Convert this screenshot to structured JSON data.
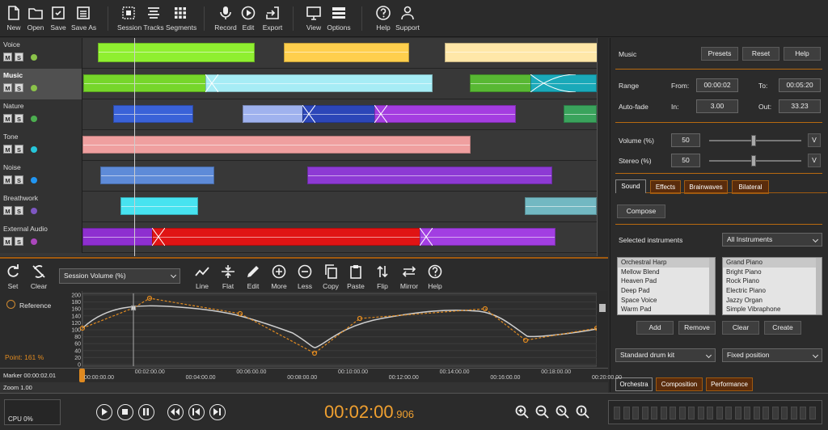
{
  "toolbar": [
    {
      "label": "New",
      "icon": "new-file-icon"
    },
    {
      "label": "Open",
      "icon": "folder-icon"
    },
    {
      "label": "Save",
      "icon": "save-icon"
    },
    {
      "label": "Save As",
      "icon": "save-as-icon"
    },
    {
      "label": "Session",
      "icon": "session-icon"
    },
    {
      "label": "Tracks",
      "icon": "tracks-icon"
    },
    {
      "label": "Segments",
      "icon": "segments-icon"
    },
    {
      "label": "Record",
      "icon": "microphone-icon"
    },
    {
      "label": "Edit",
      "icon": "edit-icon"
    },
    {
      "label": "Export",
      "icon": "export-icon"
    },
    {
      "label": "View",
      "icon": "monitor-icon"
    },
    {
      "label": "Options",
      "icon": "options-icon"
    },
    {
      "label": "Help",
      "icon": "help-icon"
    },
    {
      "label": "Support",
      "icon": "user-icon"
    }
  ],
  "tracks": [
    {
      "name": "Voice",
      "color": "#8bc34a",
      "selected": false
    },
    {
      "name": "Music",
      "color": "#8bc34a",
      "selected": true
    },
    {
      "name": "Nature",
      "color": "#4caf50",
      "selected": false
    },
    {
      "name": "Tone",
      "color": "#26c6da",
      "selected": false
    },
    {
      "name": "Noise",
      "color": "#2196f3",
      "selected": false
    },
    {
      "name": "Breathwork",
      "color": "#7e57c2",
      "selected": false
    },
    {
      "name": "External Audio",
      "color": "#ab47bc",
      "selected": false
    }
  ],
  "mute_label": "M",
  "solo_label": "S",
  "panel": {
    "title": "Music",
    "presets": "Presets",
    "reset": "Reset",
    "help": "Help",
    "range_label": "Range",
    "from_label": "From:",
    "from": "00:00:02",
    "to_label": "To:",
    "to": "00:05:20",
    "autofade_label": "Auto-fade",
    "in_label": "In:",
    "in": "3.00",
    "out_label": "Out:",
    "out": "33.23",
    "volume_label": "Volume (%)",
    "volume": "50",
    "stereo_label": "Stereo (%)",
    "stereo": "50",
    "v": "V",
    "tabs": [
      "Sound",
      "Effects",
      "Brainwaves",
      "Bilateral"
    ],
    "compose": "Compose",
    "selected_instruments": "Selected instruments",
    "instrument_filter": "All Instruments",
    "left_list": [
      "Orchestral Harp",
      "Mellow Blend",
      "Heaven Pad",
      "Deep Pad",
      "Space Voice",
      "Warm Pad"
    ],
    "right_list": [
      "Grand Piano",
      "Bright Piano",
      "Rock Piano",
      "Electric Piano",
      "Jazzy Organ",
      "Simple Vibraphone"
    ],
    "add": "Add",
    "remove": "Remove",
    "clear": "Clear",
    "create": "Create",
    "drum_kit": "Standard drum kit",
    "position": "Fixed position",
    "bottom_tabs": [
      "Orchestra",
      "Composition",
      "Performance"
    ]
  },
  "automation": {
    "set": "Set",
    "clear": "Clear",
    "dropdown": "Session Volume (%)",
    "tools": [
      "Line",
      "Flat",
      "Edit",
      "More",
      "Less",
      "Copy",
      "Paste",
      "Flip",
      "Mirror",
      "Help"
    ],
    "reference": "Reference",
    "point": "Point: 161 %",
    "yticks": [
      "200",
      "180",
      "160",
      "140",
      "120",
      "100",
      "80",
      "60",
      "40",
      "20",
      "0"
    ],
    "marker": "Marker 00:00:02.01",
    "zoom": "Zoom 1.00",
    "ruler": [
      "00:00:00.00",
      "00:02:00.00",
      "00:04:00.00",
      "00:06:00.00",
      "00:08:00.00",
      "00:10:00.00",
      "00:12:00.00",
      "00:14:00.00",
      "00:16:00.00",
      "00:18:00.00",
      "00:20:00.00"
    ]
  },
  "transport": {
    "cpu": "CPU 0%",
    "time_main": "00:02:00",
    "time_ms": ".906"
  }
}
